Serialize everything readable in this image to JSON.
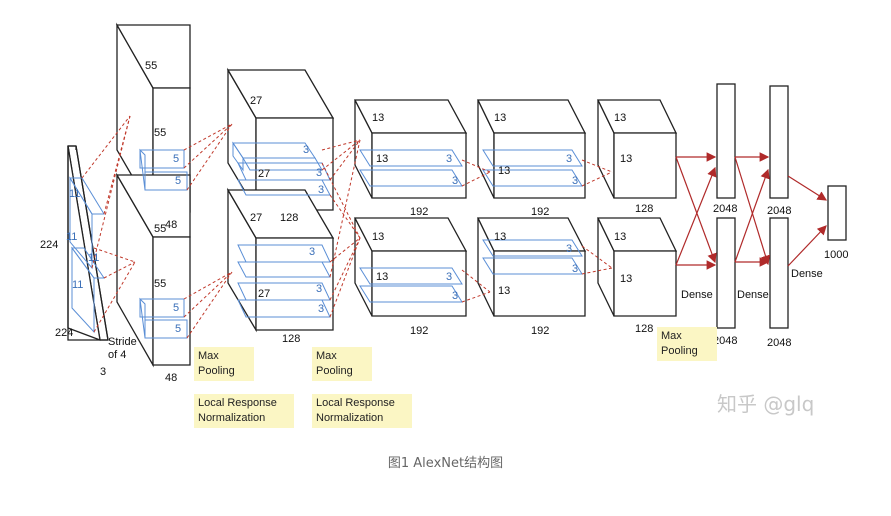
{
  "diagram": {
    "input": {
      "size": "224",
      "side": "224",
      "depth": "3",
      "kernel_a": "11",
      "kernel_b": "11",
      "kernel_c": "11",
      "kernel_d": "11",
      "stride": "Stride\nof 4"
    },
    "conv1": {
      "top_a": "55",
      "top_b": "55",
      "top_depth": "48",
      "bot_a": "55",
      "bot_b": "55",
      "bot_depth": "48",
      "k1": "5",
      "k2": "5",
      "k3": "5",
      "k4": "5"
    },
    "conv2": {
      "top_a": "27",
      "top_b": "27",
      "top_w": "27",
      "top_depth": "128",
      "bot_a": "27",
      "bot_depth": "128",
      "k1": "3",
      "k2": "3",
      "k3": "3",
      "k4": "3",
      "k5": "3",
      "k6": "3"
    },
    "conv3": {
      "top_a": "13",
      "top_b": "13",
      "top_depth": "192",
      "bot_a": "13",
      "bot_b": "13",
      "bot_depth": "192",
      "k1": "3",
      "k2": "3",
      "k3": "3",
      "k4": "3"
    },
    "conv4": {
      "top_a": "13",
      "top_b": "13",
      "top_depth": "192",
      "bot_a": "13",
      "bot_b": "13",
      "bot_depth": "192",
      "k1": "3",
      "k2": "3",
      "k3": "3",
      "k4": "3"
    },
    "conv5": {
      "top_a": "13",
      "top_b": "13",
      "top_depth": "128",
      "bot_a": "13",
      "bot_b": "13",
      "bot_depth": "128"
    },
    "fc": {
      "fc1_top": "2048",
      "fc1_bot": "2048",
      "fc2_top": "2048",
      "fc2_bot": "2048",
      "out": "1000",
      "dense1": "Dense",
      "dense2": "Dense",
      "dense3": "Dense"
    },
    "notes": {
      "pool1": "Max\nPooling",
      "lrn1": "Local Response\nNormalization",
      "pool2": "Max\nPooling",
      "lrn2": "Local Response\nNormalization",
      "pool3": "Max\nPooling"
    },
    "colors": {
      "connection": "#c0392b",
      "kernel": "#5b8fd6",
      "box": "#222222",
      "note_bg": "#fbf6c4"
    }
  },
  "caption": "图1 AlexNet结构图",
  "watermark": "知乎 @glq"
}
